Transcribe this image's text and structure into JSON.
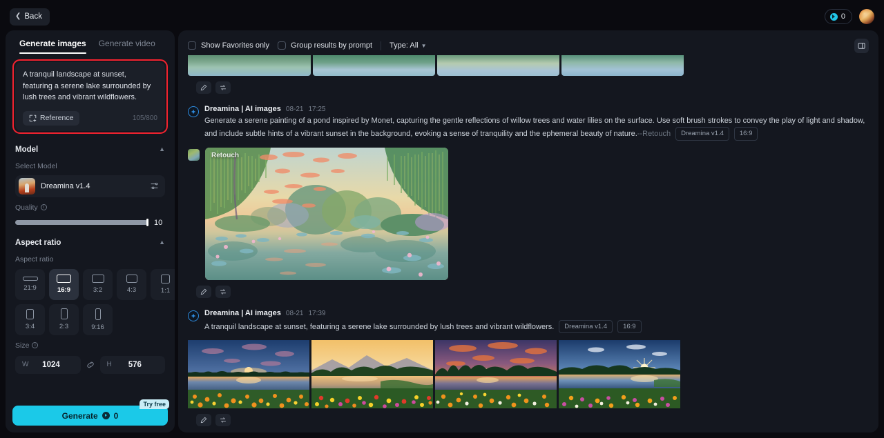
{
  "topbar": {
    "back_label": "Back",
    "credits": "0",
    "back_icon": "chevron-left-icon",
    "coin_icon": "credit-coin-icon",
    "avatar_icon": "user-avatar"
  },
  "sidebar": {
    "tabs": [
      {
        "label": "Generate images",
        "active": true
      },
      {
        "label": "Generate video",
        "active": false
      }
    ],
    "prompt": {
      "value": "A tranquil landscape at sunset, featuring a serene lake surrounded by lush trees and vibrant wildflowers.",
      "reference_label": "Reference",
      "reference_icon": "add-image-icon",
      "char_count": "105/800",
      "highlight_color": "#f5232f"
    },
    "model": {
      "section_title": "Model",
      "sub_label": "Select Model",
      "name": "Dreamina v1.4",
      "settings_icon": "sliders-icon",
      "collapse_icon": "chevron-up-icon"
    },
    "quality": {
      "label": "Quality",
      "info_icon": "info-icon",
      "value": "10",
      "percent": 100
    },
    "aspect_ratio": {
      "section_title": "Aspect ratio",
      "sub_label": "Aspect ratio",
      "collapse_icon": "chevron-up-icon",
      "options": [
        {
          "label": "21:9",
          "w": 22,
          "h": 6,
          "selected": false
        },
        {
          "label": "16:9",
          "w": 21,
          "h": 12,
          "selected": true
        },
        {
          "label": "3:2",
          "w": 18,
          "h": 12,
          "selected": false
        },
        {
          "label": "4:3",
          "w": 16,
          "h": 12,
          "selected": false
        },
        {
          "label": "1:1",
          "w": 13,
          "h": 13,
          "selected": false
        },
        {
          "label": "3:4",
          "w": 11,
          "h": 15,
          "selected": false
        },
        {
          "label": "2:3",
          "w": 10,
          "h": 16,
          "selected": false
        },
        {
          "label": "9:16",
          "w": 8,
          "h": 17,
          "selected": false
        }
      ]
    },
    "size": {
      "label": "Size",
      "info_icon": "info-icon",
      "width_key": "W",
      "width_value": "1024",
      "link_icon": "link-icon",
      "height_key": "H",
      "height_value": "576"
    },
    "generate": {
      "label": "Generate",
      "cost": "0",
      "badge": "Try free",
      "accent_color": "#1bc9e8"
    }
  },
  "results_panel": {
    "filters": {
      "favorites_label": "Show Favorites only",
      "favorites_checked": false,
      "group_label": "Group results by prompt",
      "group_checked": false,
      "type_label": "Type: All",
      "type_caret_icon": "chevron-down-icon",
      "panel_toggle_icon": "panel-window-icon"
    },
    "actions": {
      "edit_icon": "pencil-edit-icon",
      "regenerate_icon": "swap-arrows-icon"
    },
    "results": [
      {
        "title": "Dreamina | AI images",
        "date": "08-21",
        "time": "17:25",
        "prompt": "Generate a serene painting of a pond inspired by Monet, capturing the gentle reflections of willow trees and water lilies on the surface. Use soft brush strokes to convey the play of light and shadow, and include subtle hints of a vibrant sunset in the background, evoking a sense of tranquility and the ephemeral beauty of nature.",
        "retouch_suffix": "--Retouch",
        "tags": [
          "Dreamina v1.4",
          "16:9"
        ],
        "image_overlay_label": "Retouch",
        "image_alt": "monet-style-pond-painting"
      },
      {
        "title": "Dreamina | AI images",
        "date": "08-21",
        "time": "17:39",
        "prompt": "A tranquil landscape at sunset, featuring a serene lake surrounded by lush trees and vibrant wildflowers.",
        "tags": [
          "Dreamina v1.4",
          "16:9"
        ],
        "image_alts": [
          "sunset-lake-orange-flowers",
          "sunset-lake-mountains-mixed-flowers",
          "sunset-lake-purple-sky-daisies",
          "sunset-lake-starburst-pink-flowers"
        ]
      }
    ]
  }
}
